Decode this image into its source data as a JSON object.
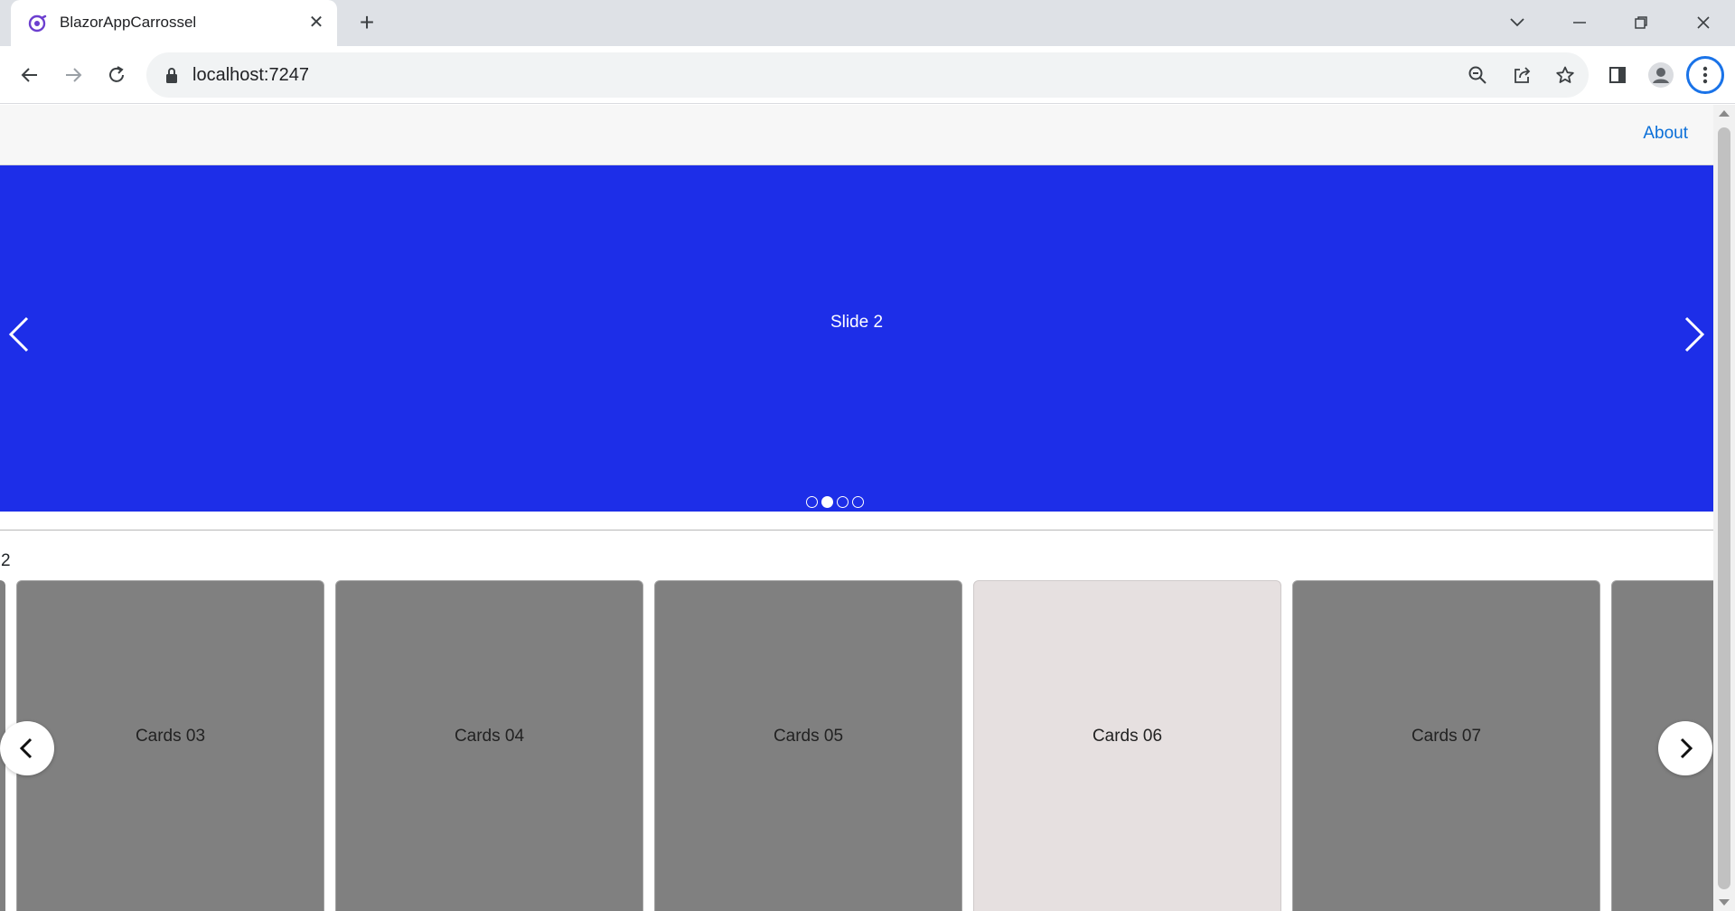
{
  "browser": {
    "tab_title": "BlazorAppCarrossel",
    "url": "localhost:7247"
  },
  "nav": {
    "about_label": "About"
  },
  "hero": {
    "slide_text": "Slide 2",
    "dot_count": 4,
    "active_dot": 2,
    "background_color": "#1d2ee8"
  },
  "current_index": "2",
  "cards": [
    {
      "label": "Cards 03",
      "highlighted": false
    },
    {
      "label": "Cards 04",
      "highlighted": false
    },
    {
      "label": "Cards 05",
      "highlighted": false
    },
    {
      "label": "Cards 06",
      "highlighted": true
    },
    {
      "label": "Cards 07",
      "highlighted": false
    },
    {
      "label": "",
      "highlighted": false
    }
  ],
  "colors": {
    "card_default": "#808080",
    "card_highlight": "#e6e0e0",
    "link": "#0b6fd8"
  },
  "icons": {
    "favicon": "blazor-icon",
    "prev": "chevron-left-icon",
    "next": "chevron-right-icon"
  }
}
